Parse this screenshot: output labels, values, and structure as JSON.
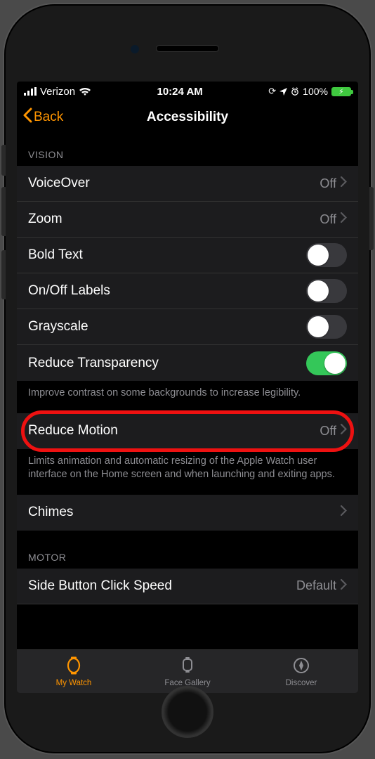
{
  "status": {
    "carrier": "Verizon",
    "time": "10:24 AM",
    "battery_pct": "100%"
  },
  "nav": {
    "back": "Back",
    "title": "Accessibility"
  },
  "sections": {
    "vision_header": "VISION",
    "motor_header": "MOTOR"
  },
  "rows": {
    "voiceover": {
      "label": "VoiceOver",
      "value": "Off"
    },
    "zoom": {
      "label": "Zoom",
      "value": "Off"
    },
    "bold_text": {
      "label": "Bold Text"
    },
    "onoff_labels": {
      "label": "On/Off Labels"
    },
    "grayscale": {
      "label": "Grayscale"
    },
    "reduce_transparency": {
      "label": "Reduce Transparency"
    },
    "reduce_transparency_footer": "Improve contrast on some backgrounds to increase legibility.",
    "reduce_motion": {
      "label": "Reduce Motion",
      "value": "Off"
    },
    "reduce_motion_footer": "Limits animation and automatic resizing of the Apple Watch user interface on the Home screen and when launching and exiting apps.",
    "chimes": {
      "label": "Chimes"
    },
    "side_button": {
      "label": "Side Button Click Speed",
      "value": "Default"
    }
  },
  "tabs": {
    "my_watch": "My Watch",
    "face_gallery": "Face Gallery",
    "discover": "Discover"
  }
}
